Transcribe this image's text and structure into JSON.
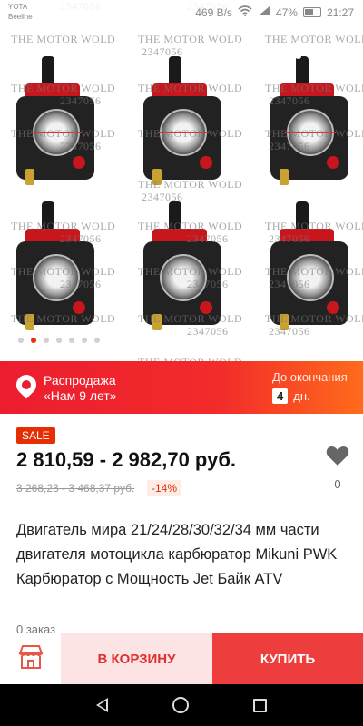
{
  "status_bar": {
    "carrier_1": "YOTA",
    "carrier_2": "Beeline",
    "speed": "469 B/s",
    "battery": "47%",
    "time": "21:27"
  },
  "gallery": {
    "watermark_name": "THE MOTOR WOLD",
    "watermark_id": "2347056",
    "image_count": 7,
    "active_index": 1
  },
  "sale_banner": {
    "title": "Распродажа",
    "subtitle": "«Нам 9 лет»",
    "until_label": "До окончания",
    "days_value": "4",
    "days_unit": "дн."
  },
  "price": {
    "sale_badge": "SALE",
    "current": "2 810,59 - 2 982,70 руб.",
    "old": "3 268,23 - 3 468,37 руб.",
    "discount": "-14%"
  },
  "wishlist": {
    "count": "0"
  },
  "product": {
    "title": "Двигатель мира 21/24/28/30/32/34 мм части двигателя мотоцикла карбюратор Mikuni PWK Карбюратор с Мощность Jet Байк ATV",
    "orders": "0 заказ"
  },
  "actions": {
    "cart_label": "В КОРЗИНУ",
    "buy_label": "КУПИТЬ"
  },
  "colors": {
    "accent": "#e62e04",
    "banner": "#ec1d2f",
    "buy": "#ee3d3d",
    "cart_bg": "#fde4e4"
  },
  "icons": [
    "back-arrow-icon",
    "cart-icon",
    "share-icon",
    "more-icon",
    "location-pin-icon",
    "heart-icon",
    "store-icon",
    "nav-back-icon",
    "nav-home-icon",
    "nav-recents-icon"
  ]
}
